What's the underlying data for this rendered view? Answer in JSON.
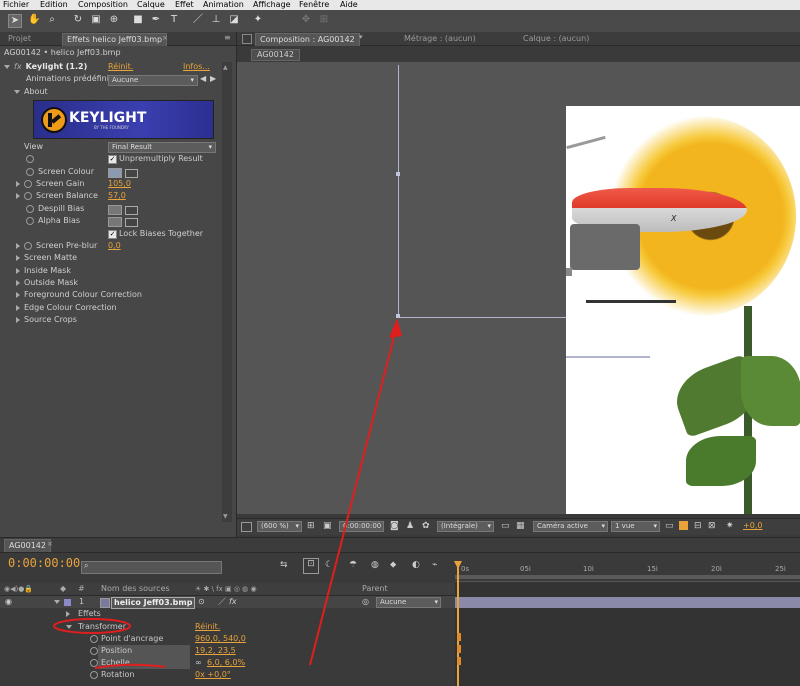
{
  "menu": [
    "Fichier",
    "Edition",
    "Composition",
    "Calque",
    "Effet",
    "Animation",
    "Affichage",
    "Fenêtre",
    "Aide"
  ],
  "left_panel": {
    "tabs": [
      "Projet",
      "Effets helico Jeff03.bmp"
    ],
    "breadcrumb": "AG00142 • helico Jeff03.bmp",
    "effect_name": "Keylight (1.2)",
    "reset_label": "Réinit.",
    "info_label": "Infos...",
    "presets_label": "Animations prédéfini",
    "presets_value": "Aucune",
    "about_label": "About",
    "logo_text": "KEYLIGHT",
    "logo_sub": "BY THE FOUNDRY",
    "view_label": "View",
    "view_value": "Final Result",
    "unpremultiply_label": "Unpremultiply Result",
    "screen_colour_label": "Screen Colour",
    "screen_gain_label": "Screen Gain",
    "screen_gain_value": "105,0",
    "screen_balance_label": "Screen Balance",
    "screen_balance_value": "57,0",
    "despill_bias_label": "Despill Bias",
    "alpha_bias_label": "Alpha Bias",
    "lock_biases_label": "Lock Biases Together",
    "screen_preblur_label": "Screen Pre-blur",
    "screen_preblur_value": "0,0",
    "groups": [
      "Screen Matte",
      "Inside Mask",
      "Outside Mask",
      "Foreground Colour Correction",
      "Edge Colour Correction",
      "Source Crops"
    ]
  },
  "viewer": {
    "tabs": [
      "Composition : AG00142",
      "Métrage : (aucun)",
      "Calque : (aucun)"
    ],
    "comp_button": "AG00142",
    "bottom": {
      "zoom": "(600 %)",
      "time": "0:00:00:00",
      "resolution": "(Intégrale)",
      "camera": "Caméra active",
      "views": "1 vue",
      "exposure": "+0,0"
    }
  },
  "timeline": {
    "tab": "AG00142",
    "timecode": "0:00:00:00",
    "col_hash": "#",
    "col_source": "Nom des sources",
    "col_parent": "Parent",
    "layer_number": "1",
    "layer_name": "helico Jeff03.bmp",
    "parent_value": "Aucune",
    "effects_label": "Effets",
    "transform_label": "Transformer",
    "transform_reset": "Réinit.",
    "props": [
      {
        "name": "Point d'ancrage",
        "value": "960,0, 540,0"
      },
      {
        "name": "Position",
        "value": "19,2, 23,5"
      },
      {
        "name": "Echelle",
        "value": "6,0, 6,0%"
      },
      {
        "name": "Rotation",
        "value": "0x +0,0°"
      }
    ],
    "ruler": [
      "0s",
      "05i",
      "10i",
      "15i",
      "20i",
      "25i"
    ]
  },
  "colors": {
    "accent": "#e8a33a",
    "annotation": "#e01e1e",
    "screen_colour": "#8a9ab0"
  }
}
